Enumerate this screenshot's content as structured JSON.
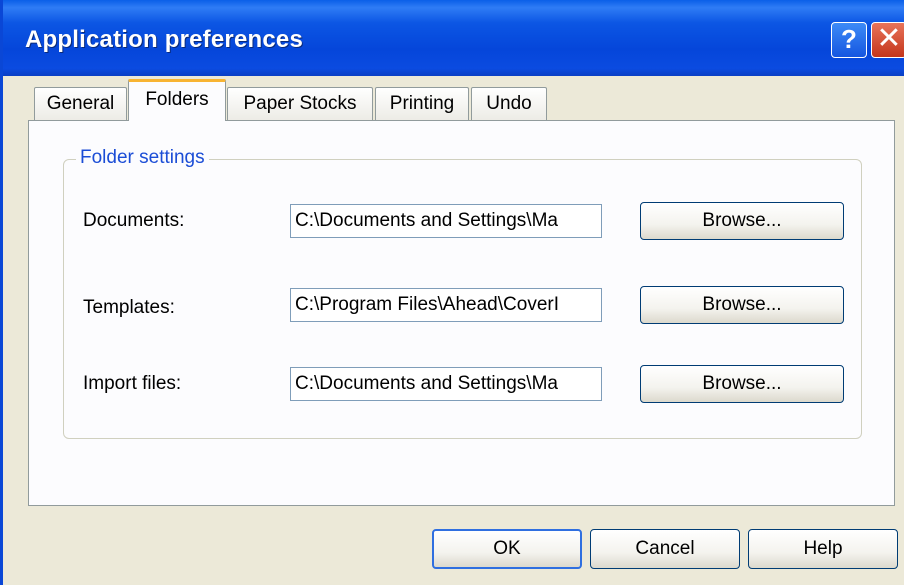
{
  "window": {
    "title": "Application preferences",
    "help_glyph": "?",
    "close_glyph": "✕"
  },
  "tabs": [
    {
      "label": "General",
      "active": false
    },
    {
      "label": "Folders",
      "active": true
    },
    {
      "label": "Paper Stocks",
      "active": false
    },
    {
      "label": "Printing",
      "active": false
    },
    {
      "label": "Undo",
      "active": false
    }
  ],
  "folder_settings": {
    "legend": "Folder settings",
    "rows": [
      {
        "label": "Documents:",
        "value": "C:\\Documents and Settings\\Ma",
        "browse_label": "Browse..."
      },
      {
        "label": "Templates:",
        "value": "C:\\Program Files\\Ahead\\CoverI",
        "browse_label": "Browse..."
      },
      {
        "label": "Import files:",
        "value": "C:\\Documents and Settings\\Ma",
        "browse_label": "Browse..."
      }
    ]
  },
  "footer": {
    "ok_label": "OK",
    "cancel_label": "Cancel",
    "help_label": "Help"
  },
  "colors": {
    "titlebar": "#0546da",
    "accent_legend": "#1b4dd6",
    "active_tab_highlight": "#f8b432"
  }
}
